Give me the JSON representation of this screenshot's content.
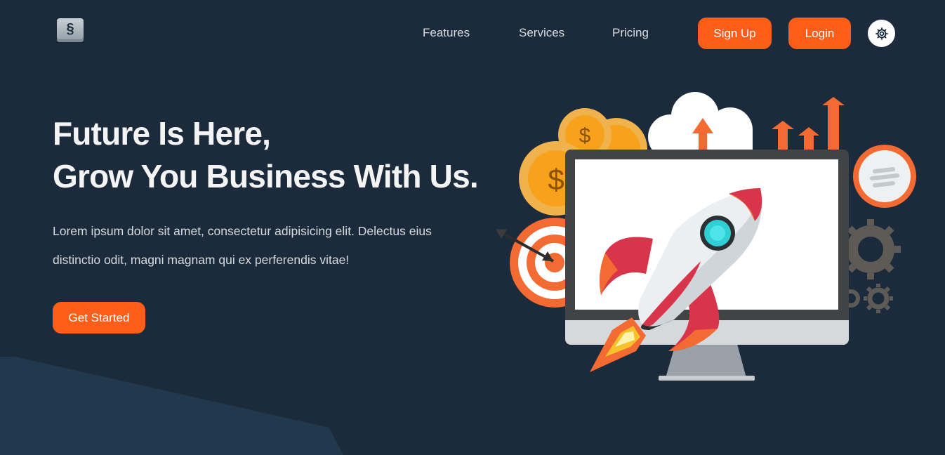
{
  "logo": {
    "glyph": "§",
    "icon": "logo-icon"
  },
  "nav": {
    "links": [
      {
        "label": "Features"
      },
      {
        "label": "Services"
      },
      {
        "label": "Pricing"
      }
    ],
    "signup_label": "Sign Up",
    "login_label": "Login",
    "settings_icon": "gear-icon"
  },
  "hero": {
    "title_line1": "Future Is Here,",
    "title_line2": "Grow You Business With Us.",
    "description_line1": "Lorem ipsum dolor sit amet, consectetur adipisicing elit. Delectus eius",
    "description_line2": "distinctio odit, magni magnam qui ex perferendis vitae!",
    "cta_label": "Get Started"
  },
  "illustration": {
    "coin_symbol": "$",
    "name": "rocket-launch-illustration"
  },
  "colors": {
    "background": "#1c2b3b",
    "accent": "#fe5e1a",
    "coin": "#f7a21a"
  }
}
